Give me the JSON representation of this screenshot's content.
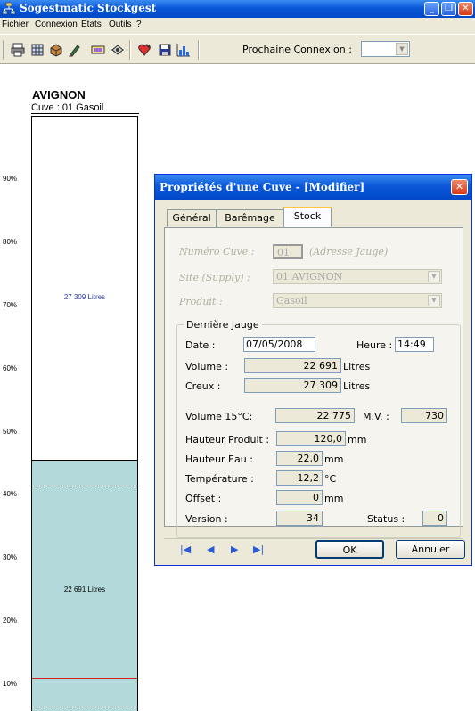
{
  "window": {
    "title": "Sogestmatic Stockgest",
    "buttons": {
      "minimize": "_",
      "maximize": "❐",
      "close": "✕"
    }
  },
  "menu": [
    "Fichier",
    "Connexion",
    "Etats",
    "Outils",
    "?"
  ],
  "toolbar": {
    "icons": [
      "print-icon",
      "database-icon",
      "tank-icon",
      "pen-icon",
      "display-icon",
      "disk-icon",
      "heart-icon",
      "save-icon",
      "chart-icon"
    ],
    "next_connection_label": "Prochaine Connexion :",
    "next_connection_value": ""
  },
  "tank": {
    "site": "AVIGNON",
    "cuve": "Cuve : 01 Gasoil",
    "fill_percent": 45.4,
    "empty_label": "27 309 Litres",
    "volume_label": "22 691 Litres",
    "ticks": [
      "90%",
      "80%",
      "70%",
      "60%",
      "50%",
      "40%",
      "30%",
      "20%",
      "10%"
    ],
    "red_line_percent": 11
  },
  "dialog": {
    "title": "Propriétés d'une Cuve - [Modifier]",
    "tabs": [
      "Général",
      "Barêmage",
      "Stock"
    ],
    "active_tab": "Stock",
    "numero_label": "Numéro Cuve :",
    "numero_value": "01",
    "adresse_label": "(Adresse Jauge)",
    "site_label": "Site (Supply) :",
    "site_value": "01  AVIGNON",
    "produit_label": "Produit :",
    "produit_value": "Gasoil",
    "group_title": "Dernière Jauge",
    "date_label": "Date :",
    "date_value": "07/05/2008",
    "heure_label": "Heure :",
    "heure_value": "14:49",
    "volume_label": "Volume :",
    "volume_value": "22 691",
    "volume_unit": "Litres",
    "creux_label": "Creux :",
    "creux_value": "27 309",
    "creux_unit": "Litres",
    "vol15_label": "Volume 15°C:",
    "vol15_value": "22 775",
    "mv_label": "M.V. :",
    "mv_value": "730",
    "hauteur_produit_label": "Hauteur Produit :",
    "hauteur_produit_value": "120,0",
    "hauteur_produit_unit": "mm",
    "hauteur_eau_label": "Hauteur Eau :",
    "hauteur_eau_value": "22,0",
    "hauteur_eau_unit": "mm",
    "temperature_label": "Température :",
    "temperature_value": "12,2",
    "temperature_unit": "°C",
    "offset_label": "Offset :",
    "offset_value": "0",
    "offset_unit": "mm",
    "version_label": "Version :",
    "version_value": "34",
    "status_label": "Status :",
    "status_value": "0",
    "nav": {
      "first": "|◀",
      "prev": "◀",
      "next": "▶",
      "last": "▶|"
    },
    "ok_label": "OK",
    "cancel_label": "Annuler"
  }
}
